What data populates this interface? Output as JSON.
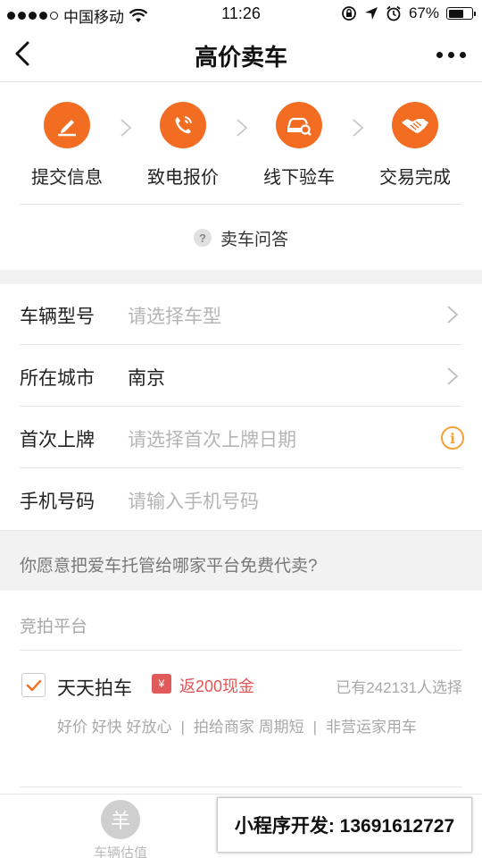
{
  "status_bar": {
    "carrier": "中国移动",
    "time": "11:26",
    "battery": "67%",
    "battery_level": 0.67
  },
  "nav": {
    "title": "高价卖车"
  },
  "steps": [
    {
      "label": "提交信息",
      "icon": "pen-icon"
    },
    {
      "label": "致电报价",
      "icon": "phone-icon"
    },
    {
      "label": "线下验车",
      "icon": "car-inspect-icon"
    },
    {
      "label": "交易完成",
      "icon": "handshake-icon"
    }
  ],
  "faq": {
    "icon_text": "?",
    "label": "卖车问答"
  },
  "form": {
    "vehicle_model": {
      "label": "车辆型号",
      "placeholder": "请选择车型"
    },
    "city": {
      "label": "所在城市",
      "value": "南京"
    },
    "first_registration": {
      "label": "首次上牌",
      "placeholder": "请选择首次上牌日期"
    },
    "phone": {
      "label": "手机号码",
      "placeholder": "请输入手机号码"
    }
  },
  "question": "你愿意把爱车托管给哪家平台免费代卖?",
  "platform_section": {
    "header": "竞拍平台",
    "platform": {
      "name": "天天拍车",
      "checked": true,
      "promo_icon_text": "¥",
      "promo": "返200现金",
      "chosen_count": "已有242131人选择",
      "features": [
        "好价 好快 好放心",
        "拍给商家 周期短",
        "非营运家用车"
      ],
      "separator": "|"
    }
  },
  "tab_bar": {
    "valuation": {
      "icon_text": "羊",
      "label": "车辆估值"
    }
  },
  "watermark": "小程序开发: 13691612727",
  "colors": {
    "accent": "#f26c22",
    "promo": "#e05555",
    "info": "#f2a23a"
  }
}
